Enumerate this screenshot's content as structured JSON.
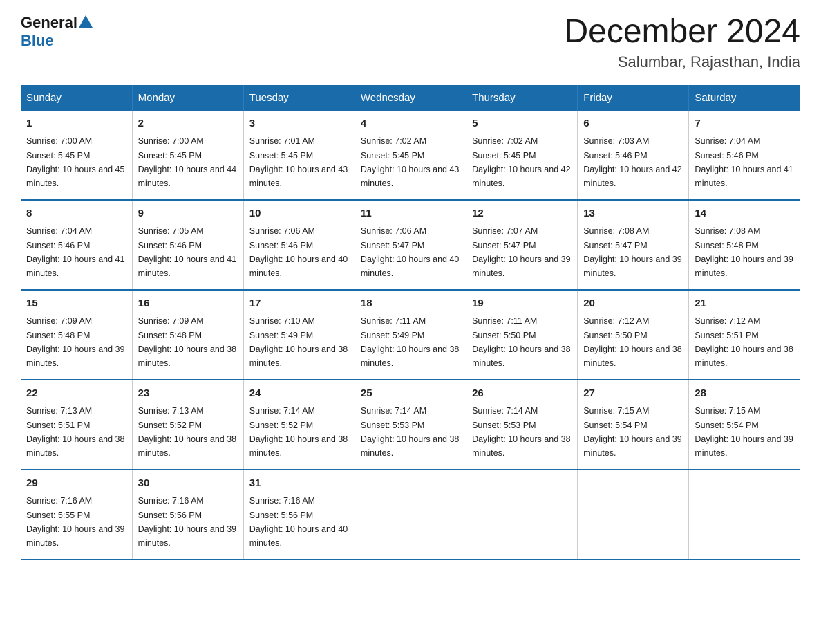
{
  "header": {
    "logo_general": "General",
    "logo_blue": "Blue",
    "month_title": "December 2024",
    "location": "Salumbar, Rajasthan, India"
  },
  "days_of_week": [
    "Sunday",
    "Monday",
    "Tuesday",
    "Wednesday",
    "Thursday",
    "Friday",
    "Saturday"
  ],
  "weeks": [
    [
      {
        "day": "1",
        "sunrise": "7:00 AM",
        "sunset": "5:45 PM",
        "daylight": "10 hours and 45 minutes."
      },
      {
        "day": "2",
        "sunrise": "7:00 AM",
        "sunset": "5:45 PM",
        "daylight": "10 hours and 44 minutes."
      },
      {
        "day": "3",
        "sunrise": "7:01 AM",
        "sunset": "5:45 PM",
        "daylight": "10 hours and 43 minutes."
      },
      {
        "day": "4",
        "sunrise": "7:02 AM",
        "sunset": "5:45 PM",
        "daylight": "10 hours and 43 minutes."
      },
      {
        "day": "5",
        "sunrise": "7:02 AM",
        "sunset": "5:45 PM",
        "daylight": "10 hours and 42 minutes."
      },
      {
        "day": "6",
        "sunrise": "7:03 AM",
        "sunset": "5:46 PM",
        "daylight": "10 hours and 42 minutes."
      },
      {
        "day": "7",
        "sunrise": "7:04 AM",
        "sunset": "5:46 PM",
        "daylight": "10 hours and 41 minutes."
      }
    ],
    [
      {
        "day": "8",
        "sunrise": "7:04 AM",
        "sunset": "5:46 PM",
        "daylight": "10 hours and 41 minutes."
      },
      {
        "day": "9",
        "sunrise": "7:05 AM",
        "sunset": "5:46 PM",
        "daylight": "10 hours and 41 minutes."
      },
      {
        "day": "10",
        "sunrise": "7:06 AM",
        "sunset": "5:46 PM",
        "daylight": "10 hours and 40 minutes."
      },
      {
        "day": "11",
        "sunrise": "7:06 AM",
        "sunset": "5:47 PM",
        "daylight": "10 hours and 40 minutes."
      },
      {
        "day": "12",
        "sunrise": "7:07 AM",
        "sunset": "5:47 PM",
        "daylight": "10 hours and 39 minutes."
      },
      {
        "day": "13",
        "sunrise": "7:08 AM",
        "sunset": "5:47 PM",
        "daylight": "10 hours and 39 minutes."
      },
      {
        "day": "14",
        "sunrise": "7:08 AM",
        "sunset": "5:48 PM",
        "daylight": "10 hours and 39 minutes."
      }
    ],
    [
      {
        "day": "15",
        "sunrise": "7:09 AM",
        "sunset": "5:48 PM",
        "daylight": "10 hours and 39 minutes."
      },
      {
        "day": "16",
        "sunrise": "7:09 AM",
        "sunset": "5:48 PM",
        "daylight": "10 hours and 38 minutes."
      },
      {
        "day": "17",
        "sunrise": "7:10 AM",
        "sunset": "5:49 PM",
        "daylight": "10 hours and 38 minutes."
      },
      {
        "day": "18",
        "sunrise": "7:11 AM",
        "sunset": "5:49 PM",
        "daylight": "10 hours and 38 minutes."
      },
      {
        "day": "19",
        "sunrise": "7:11 AM",
        "sunset": "5:50 PM",
        "daylight": "10 hours and 38 minutes."
      },
      {
        "day": "20",
        "sunrise": "7:12 AM",
        "sunset": "5:50 PM",
        "daylight": "10 hours and 38 minutes."
      },
      {
        "day": "21",
        "sunrise": "7:12 AM",
        "sunset": "5:51 PM",
        "daylight": "10 hours and 38 minutes."
      }
    ],
    [
      {
        "day": "22",
        "sunrise": "7:13 AM",
        "sunset": "5:51 PM",
        "daylight": "10 hours and 38 minutes."
      },
      {
        "day": "23",
        "sunrise": "7:13 AM",
        "sunset": "5:52 PM",
        "daylight": "10 hours and 38 minutes."
      },
      {
        "day": "24",
        "sunrise": "7:14 AM",
        "sunset": "5:52 PM",
        "daylight": "10 hours and 38 minutes."
      },
      {
        "day": "25",
        "sunrise": "7:14 AM",
        "sunset": "5:53 PM",
        "daylight": "10 hours and 38 minutes."
      },
      {
        "day": "26",
        "sunrise": "7:14 AM",
        "sunset": "5:53 PM",
        "daylight": "10 hours and 38 minutes."
      },
      {
        "day": "27",
        "sunrise": "7:15 AM",
        "sunset": "5:54 PM",
        "daylight": "10 hours and 39 minutes."
      },
      {
        "day": "28",
        "sunrise": "7:15 AM",
        "sunset": "5:54 PM",
        "daylight": "10 hours and 39 minutes."
      }
    ],
    [
      {
        "day": "29",
        "sunrise": "7:16 AM",
        "sunset": "5:55 PM",
        "daylight": "10 hours and 39 minutes."
      },
      {
        "day": "30",
        "sunrise": "7:16 AM",
        "sunset": "5:56 PM",
        "daylight": "10 hours and 39 minutes."
      },
      {
        "day": "31",
        "sunrise": "7:16 AM",
        "sunset": "5:56 PM",
        "daylight": "10 hours and 40 minutes."
      },
      null,
      null,
      null,
      null
    ]
  ]
}
